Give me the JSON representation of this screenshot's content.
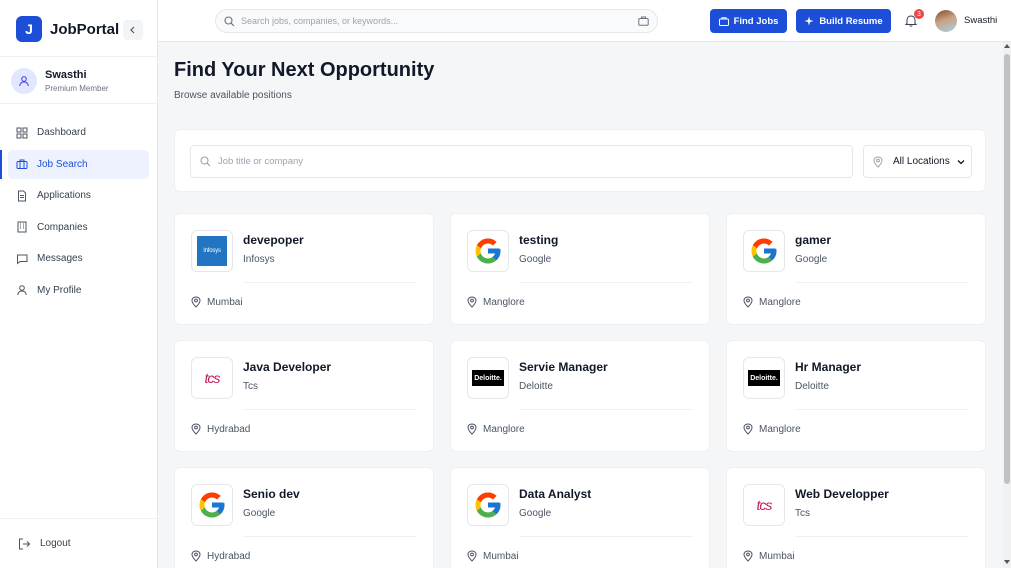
{
  "brand": {
    "logo_letter": "J",
    "name": "JobPortal"
  },
  "user": {
    "name": "Swasthi",
    "role": "Premium Member"
  },
  "nav": [
    {
      "label": "Dashboard",
      "icon": "dashboard-icon"
    },
    {
      "label": "Job Search",
      "icon": "briefcase-icon",
      "active": true
    },
    {
      "label": "Applications",
      "icon": "file-icon"
    },
    {
      "label": "Companies",
      "icon": "building-icon"
    },
    {
      "label": "Messages",
      "icon": "message-icon"
    },
    {
      "label": "My Profile",
      "icon": "user-icon"
    }
  ],
  "logout_label": "Logout",
  "topbar": {
    "search_placeholder": "Search jobs, companies, or keywords...",
    "find_jobs": "Find Jobs",
    "build_resume": "Build Resume",
    "notification_count": "3",
    "user_name": "Swasthi"
  },
  "page": {
    "title": "Find Your Next Opportunity",
    "subtitle": "Browse available positions"
  },
  "filters": {
    "search_placeholder": "Job title or company",
    "location": "All Locations"
  },
  "jobs": [
    {
      "title": "devepoper",
      "company": "Infosys",
      "location": "Mumbai",
      "logo": "infosys"
    },
    {
      "title": "testing",
      "company": "Google",
      "location": "Manglore",
      "logo": "google"
    },
    {
      "title": "gamer",
      "company": "Google",
      "location": "Manglore",
      "logo": "google"
    },
    {
      "title": "Java Developer",
      "company": "Tcs",
      "location": "Hydrabad",
      "logo": "tcs"
    },
    {
      "title": "Servie Manager",
      "company": "Deloitte",
      "location": "Manglore",
      "logo": "deloitte"
    },
    {
      "title": "Hr Manager",
      "company": "Deloitte",
      "location": "Manglore",
      "logo": "deloitte"
    },
    {
      "title": "Senio dev",
      "company": "Google",
      "location": "Hydrabad",
      "logo": "google"
    },
    {
      "title": "Data Analyst",
      "company": "Google",
      "location": "Mumbai",
      "logo": "google"
    },
    {
      "title": "Web Developper",
      "company": "Tcs",
      "location": "Mumbai",
      "logo": "tcs"
    }
  ],
  "logo_text": {
    "infosys": "Infosys",
    "tcs": "tcs",
    "deloitte": "Deloitte.",
    "google": "G"
  },
  "colors": {
    "accent": "#1d4ed8",
    "badge": "#ef4444"
  }
}
